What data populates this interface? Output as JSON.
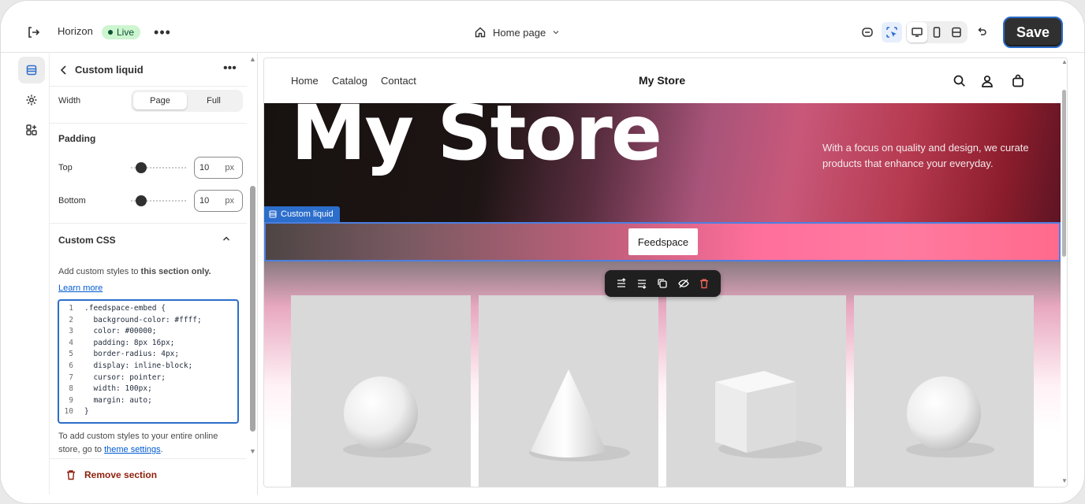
{
  "topbar": {
    "exit_icon": "exit-icon",
    "theme_name": "Horizon",
    "status_badge": "Live",
    "more_icon": "more-horizontal-icon",
    "page_select": "Home page",
    "tools": [
      "ai-assist-icon",
      "inspector-icon",
      "desktop-icon",
      "mobile-icon",
      "fullscreen-icon",
      "undo-icon"
    ],
    "save_label": "Save"
  },
  "rail": {
    "items": [
      "sections-icon",
      "settings-icon",
      "apps-icon"
    ]
  },
  "panel": {
    "title": "Custom liquid",
    "width_label": "Width",
    "width_options": [
      "Page",
      "Full"
    ],
    "width_selected": "Page",
    "padding_heading": "Padding",
    "padding_top_label": "Top",
    "padding_top_value": "10",
    "padding_bottom_label": "Bottom",
    "padding_bottom_value": "10",
    "padding_unit": "px",
    "css_heading": "Custom CSS",
    "css_help_prefix": "Add custom styles to ",
    "css_help_bold": "this section only.",
    "learn_more": "Learn more",
    "code_lines": [
      {
        "n": "1",
        "text": ".feedspace-embed {"
      },
      {
        "n": "2",
        "text": "  background-color: #ffff;"
      },
      {
        "n": "3",
        "text": "  color: #00000;"
      },
      {
        "n": "4",
        "text": "  padding: 8px 16px;"
      },
      {
        "n": "5",
        "text": "  border-radius: 4px;"
      },
      {
        "n": "6",
        "text": "  display: inline-block;"
      },
      {
        "n": "7",
        "text": "  cursor: pointer;"
      },
      {
        "n": "8",
        "text": "  width: 100px;"
      },
      {
        "n": "9",
        "text": "  margin: auto;"
      },
      {
        "n": "10",
        "text": "}"
      }
    ],
    "footer_note_prefix": "To add custom styles to your entire online store, go to ",
    "footer_link": "theme settings",
    "footer_note_suffix": ".",
    "remove_label": "Remove section"
  },
  "preview": {
    "nav_links": [
      "Home",
      "Catalog",
      "Contact"
    ],
    "store_title": "My Store",
    "nav_icons": [
      "search-icon",
      "account-icon",
      "cart-icon"
    ],
    "hero_title": "My Store",
    "hero_subtitle": "With a focus on quality and design, we curate products that enhance your everyday.",
    "section_tag": "Custom liquid",
    "button_label": "Feedspace",
    "section_toolbar": [
      "move-up-icon",
      "move-down-icon",
      "duplicate-icon",
      "hide-icon",
      "delete-icon"
    ],
    "products": [
      "sphere",
      "cone",
      "cube",
      "sphere"
    ]
  }
}
